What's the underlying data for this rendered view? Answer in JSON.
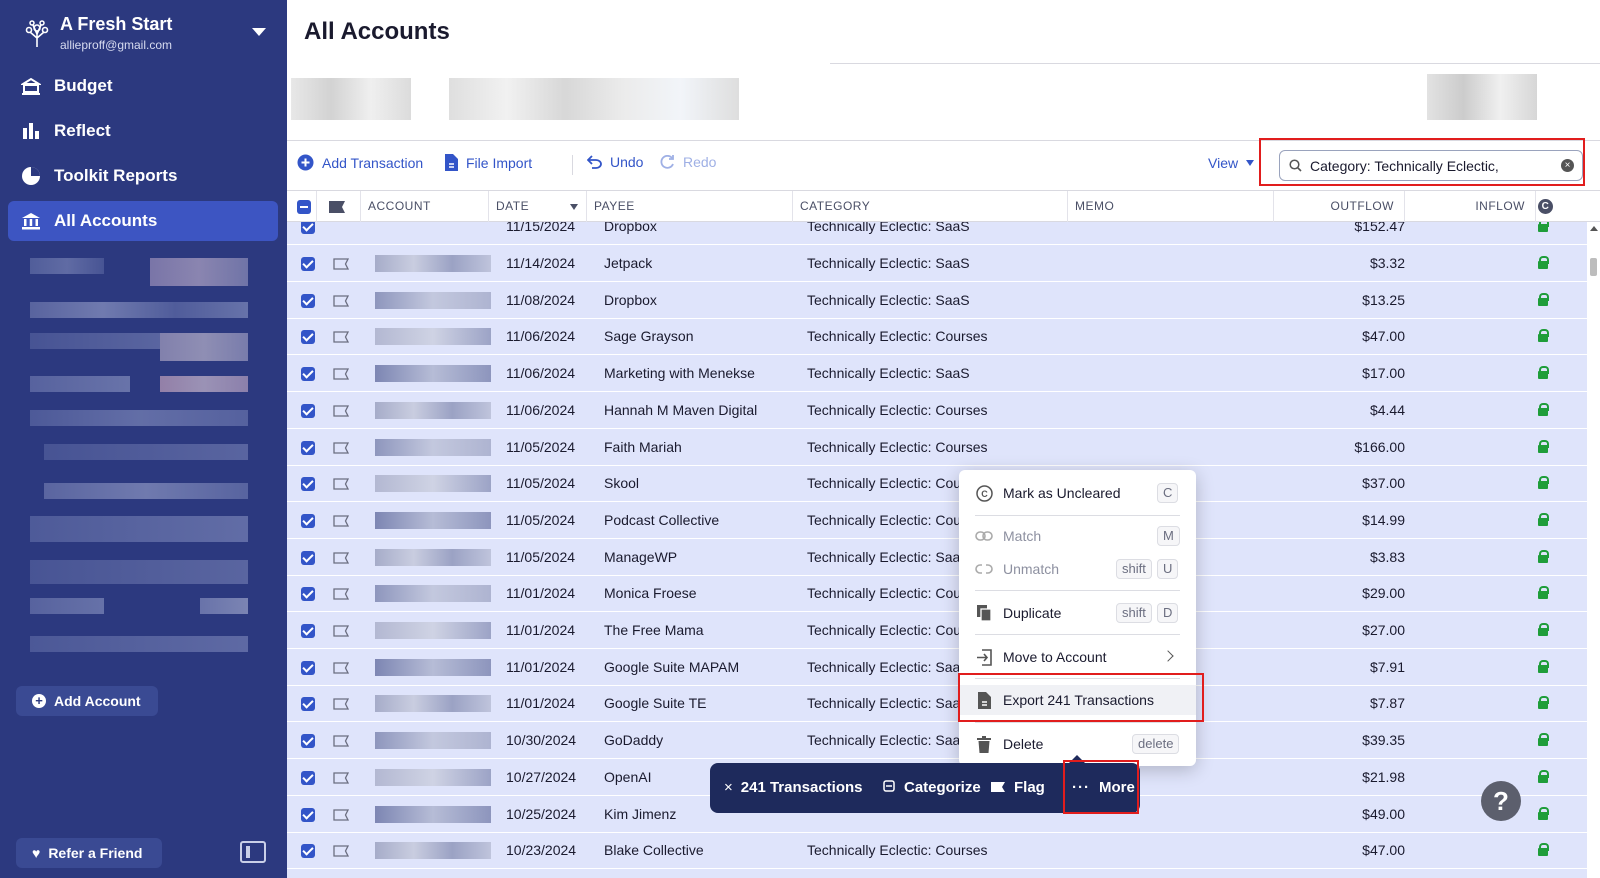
{
  "budget": {
    "name": "A Fresh Start",
    "email": "allieproff@gmail.com"
  },
  "nav": [
    {
      "label": "Budget",
      "icon": "budget-icon"
    },
    {
      "label": "Reflect",
      "icon": "bar-chart-icon"
    },
    {
      "label": "Toolkit Reports",
      "icon": "pie-chart-icon"
    },
    {
      "label": "All Accounts",
      "icon": "bank-icon",
      "active": true
    }
  ],
  "sidebar_footer": {
    "add_account": "Add Account",
    "refer": "Refer a Friend"
  },
  "page_title": "All Accounts",
  "toolbar": {
    "add_transaction": "Add Transaction",
    "file_import": "File Import",
    "undo": "Undo",
    "redo": "Redo",
    "view": "View",
    "search_value": "Category: Technically Eclectic,"
  },
  "columns": {
    "account": "ACCOUNT",
    "date": "DATE",
    "payee": "PAYEE",
    "category": "CATEGORY",
    "memo": "MEMO",
    "outflow": "OUTFLOW",
    "inflow": "INFLOW"
  },
  "rows": [
    {
      "date": "11/14/2024",
      "payee": "Jetpack",
      "category": "Technically Eclectic: SaaS",
      "outflow": "$3.32"
    },
    {
      "date": "11/08/2024",
      "payee": "Dropbox",
      "category": "Technically Eclectic: SaaS",
      "outflow": "$13.25"
    },
    {
      "date": "11/06/2024",
      "payee": "Sage Grayson",
      "category": "Technically Eclectic: Courses",
      "outflow": "$47.00"
    },
    {
      "date": "11/06/2024",
      "payee": "Marketing with Menekse",
      "category": "Technically Eclectic: SaaS",
      "outflow": "$17.00"
    },
    {
      "date": "11/06/2024",
      "payee": "Hannah M Maven Digital",
      "category": "Technically Eclectic: Courses",
      "outflow": "$4.44"
    },
    {
      "date": "11/05/2024",
      "payee": "Faith Mariah",
      "category": "Technically Eclectic: Courses",
      "outflow": "$166.00"
    },
    {
      "date": "11/05/2024",
      "payee": "Skool",
      "category": "Technically Eclectic: Cour",
      "outflow": "$37.00"
    },
    {
      "date": "11/05/2024",
      "payee": "Podcast Collective",
      "category": "Technically Eclectic: Cour",
      "outflow": "$14.99"
    },
    {
      "date": "11/05/2024",
      "payee": "ManageWP",
      "category": "Technically Eclectic: SaaS",
      "outflow": "$3.83"
    },
    {
      "date": "11/01/2024",
      "payee": "Monica Froese",
      "category": "Technically Eclectic: Cour",
      "outflow": "$29.00"
    },
    {
      "date": "11/01/2024",
      "payee": "The Free Mama",
      "category": "Technically Eclectic: Cour",
      "outflow": "$27.00"
    },
    {
      "date": "11/01/2024",
      "payee": "Google Suite MAPAM",
      "category": "Technically Eclectic: SaaS",
      "outflow": "$7.91"
    },
    {
      "date": "11/01/2024",
      "payee": "Google Suite TE",
      "category": "Technically Eclectic: SaaS",
      "outflow": "$7.87"
    },
    {
      "date": "10/30/2024",
      "payee": "GoDaddy",
      "category": "Technically Eclectic: SaaS",
      "outflow": "$39.35"
    },
    {
      "date": "10/27/2024",
      "payee": "OpenAI",
      "category": "",
      "outflow": "$21.98"
    },
    {
      "date": "10/25/2024",
      "payee": "Kim Jimenz",
      "category": "",
      "outflow": "$49.00"
    },
    {
      "date": "10/23/2024",
      "payee": "Blake Collective",
      "category": "Technically Eclectic: Courses",
      "outflow": "$47.00"
    }
  ],
  "partial_top_row": {
    "date": "11/15/2024",
    "payee": "Dropbox",
    "category": "Technically Eclectic: SaaS",
    "outflow": "$152.47"
  },
  "menu": {
    "mark_uncleared": "Mark as Uncleared",
    "mark_key": "C",
    "match": "Match",
    "match_key": "M",
    "unmatch": "Unmatch",
    "unmatch_mod": "shift",
    "unmatch_key": "U",
    "duplicate": "Duplicate",
    "duplicate_mod": "shift",
    "duplicate_key": "D",
    "move": "Move to Account",
    "export": "Export 241 Transactions",
    "delete": "Delete",
    "delete_key": "delete"
  },
  "bulk": {
    "count": "241 Transactions",
    "categorize": "Categorize",
    "flag": "Flag",
    "more": "More"
  },
  "help": "?",
  "colors": {
    "sidebar": "#2c397f",
    "accent": "#3355c8",
    "selected_row": "#dfe4fb",
    "highlight_box": "#e11d1d"
  }
}
